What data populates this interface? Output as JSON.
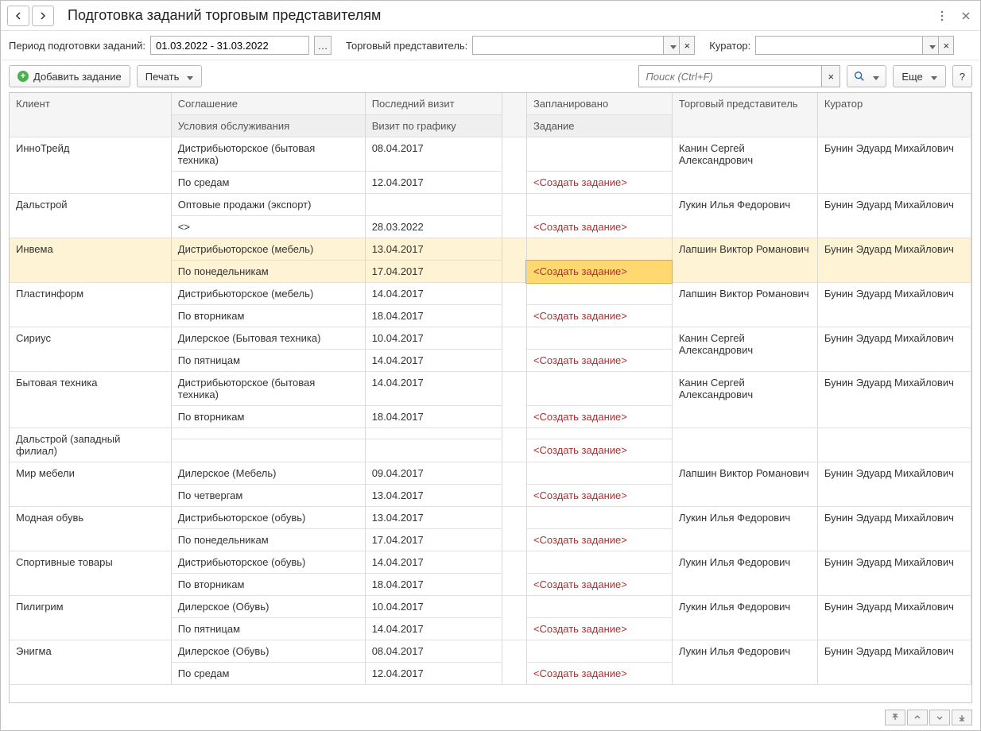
{
  "title": "Подготовка заданий торговым представителям",
  "filters": {
    "period_label": "Период подготовки заданий:",
    "period_value": "01.03.2022 - 31.03.2022",
    "rep_label": "Торговый представитель:",
    "rep_value": "",
    "curator_label": "Куратор:",
    "curator_value": ""
  },
  "toolbar": {
    "add_task": "Добавить задание",
    "print": "Печать",
    "search_placeholder": "Поиск (Ctrl+F)",
    "more": "Еще",
    "help": "?"
  },
  "columns": {
    "client": "Клиент",
    "agreement": "Соглашение",
    "conditions": "Условия обслуживания",
    "last_visit": "Последний визит",
    "scheduled_visit": "Визит по графику",
    "planned": "Запланировано",
    "task": "Задание",
    "rep": "Торговый представитель",
    "curator": "Куратор"
  },
  "create_task_text": "<Создать задание>",
  "rows": [
    {
      "client": "ИнноТрейд",
      "agreement": "Дистрибьюторское (бытовая техника)",
      "conditions": "По средам",
      "last_visit": "08.04.2017",
      "scheduled_visit": "12.04.2017",
      "planned": "",
      "rep": "Канин Сергей Александрович",
      "curator": "Бунин Эдуард Михайлович",
      "selected": false
    },
    {
      "client": "Дальстрой",
      "agreement": "Оптовые продажи (экспорт)",
      "conditions": "<>",
      "last_visit": "",
      "scheduled_visit": "28.03.2022",
      "planned": "",
      "rep": "Лукин Илья Федорович",
      "curator": "Бунин Эдуард Михайлович",
      "selected": false
    },
    {
      "client": "Инвема",
      "agreement": "Дистрибьюторское (мебель)",
      "conditions": "По понедельникам",
      "last_visit": "13.04.2017",
      "scheduled_visit": "17.04.2017",
      "planned": "",
      "rep": "Лапшин Виктор Романович",
      "curator": "Бунин Эдуард Михайлович",
      "selected": true
    },
    {
      "client": "Пластинформ",
      "agreement": "Дистрибьюторское (мебель)",
      "conditions": "По вторникам",
      "last_visit": "14.04.2017",
      "scheduled_visit": "18.04.2017",
      "planned": "",
      "rep": "Лапшин Виктор Романович",
      "curator": "Бунин Эдуард Михайлович",
      "selected": false
    },
    {
      "client": "Сириус",
      "agreement": "Дилерское (Бытовая техника)",
      "conditions": "По пятницам",
      "last_visit": "10.04.2017",
      "scheduled_visit": "14.04.2017",
      "planned": "",
      "rep": "Канин Сергей Александрович",
      "curator": "Бунин Эдуард Михайлович",
      "selected": false
    },
    {
      "client": "Бытовая техника",
      "agreement": "Дистрибьюторское (бытовая техника)",
      "conditions": "По вторникам",
      "last_visit": "14.04.2017",
      "scheduled_visit": "18.04.2017",
      "planned": "",
      "rep": "Канин Сергей Александрович",
      "curator": "Бунин Эдуард Михайлович",
      "selected": false
    },
    {
      "client": "Дальстрой (западный филиал)",
      "agreement": "",
      "conditions": "",
      "last_visit": "",
      "scheduled_visit": "",
      "planned": "",
      "rep": "",
      "curator": "",
      "selected": false
    },
    {
      "client": "Мир мебели",
      "agreement": "Дилерское (Мебель)",
      "conditions": "По четвергам",
      "last_visit": "09.04.2017",
      "scheduled_visit": "13.04.2017",
      "planned": "",
      "rep": "Лапшин Виктор Романович",
      "curator": "Бунин Эдуард Михайлович",
      "selected": false
    },
    {
      "client": "Модная обувь",
      "agreement": "Дистрибьюторское (обувь)",
      "conditions": "По понедельникам",
      "last_visit": "13.04.2017",
      "scheduled_visit": "17.04.2017",
      "planned": "",
      "rep": "Лукин Илья Федорович",
      "curator": "Бунин Эдуард Михайлович",
      "selected": false
    },
    {
      "client": "Спортивные товары",
      "agreement": "Дистрибьюторское (обувь)",
      "conditions": "По вторникам",
      "last_visit": "14.04.2017",
      "scheduled_visit": "18.04.2017",
      "planned": "",
      "rep": "Лукин Илья Федорович",
      "curator": "Бунин Эдуард Михайлович",
      "selected": false
    },
    {
      "client": "Пилигрим",
      "agreement": "Дилерское (Обувь)",
      "conditions": "По пятницам",
      "last_visit": "10.04.2017",
      "scheduled_visit": "14.04.2017",
      "planned": "",
      "rep": "Лукин Илья Федорович",
      "curator": "Бунин Эдуард Михайлович",
      "selected": false
    },
    {
      "client": "Энигма",
      "agreement": "Дилерское (Обувь)",
      "conditions": "По средам",
      "last_visit": "08.04.2017",
      "scheduled_visit": "12.04.2017",
      "planned": "",
      "rep": "Лукин Илья Федорович",
      "curator": "Бунин Эдуард Михайлович",
      "selected": false
    }
  ]
}
